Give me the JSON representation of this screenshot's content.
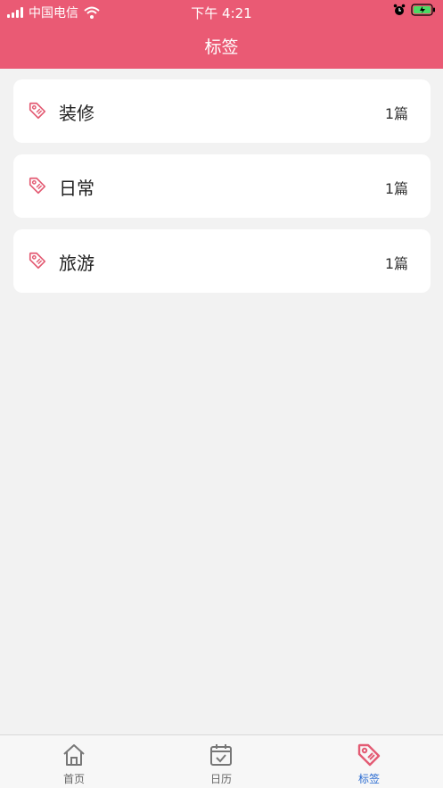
{
  "status_bar": {
    "carrier": "中国电信",
    "time": "下午 4:21"
  },
  "header": {
    "title": "标签"
  },
  "tags": [
    {
      "name": "装修",
      "count": "1篇",
      "icon": "tag-icon"
    },
    {
      "name": "日常",
      "count": "1篇",
      "icon": "tag-icon"
    },
    {
      "name": "旅游",
      "count": "1篇",
      "icon": "tag-icon"
    }
  ],
  "tabbar": {
    "items": [
      {
        "label": "首页",
        "icon": "home-icon",
        "active": false
      },
      {
        "label": "日历",
        "icon": "calendar-icon",
        "active": false
      },
      {
        "label": "标签",
        "icon": "tag-icon",
        "active": true
      }
    ]
  },
  "colors": {
    "header_bg": "#ea5a74",
    "accent_icon": "#e35b73",
    "active_tab_text": "#2a6bd1"
  }
}
